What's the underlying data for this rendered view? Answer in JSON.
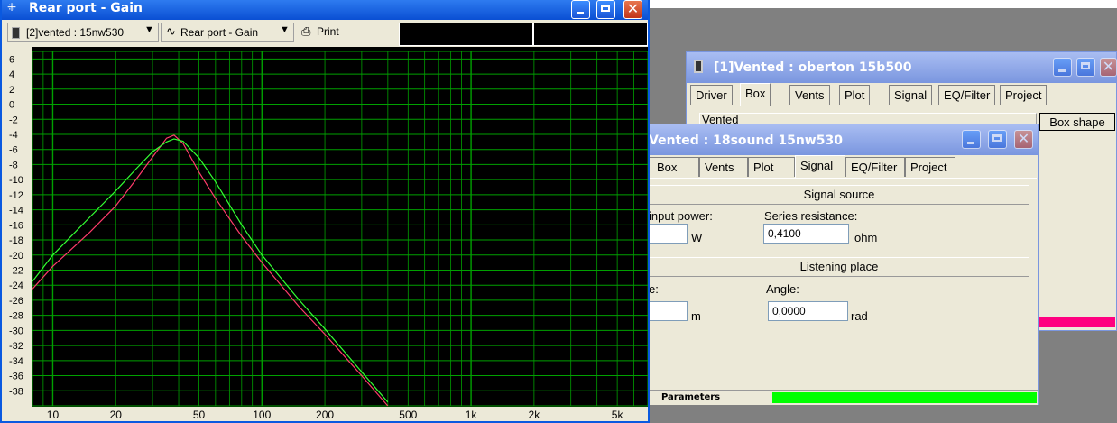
{
  "graph_window": {
    "title": "Rear port - Gain",
    "project_select": "[2]vented : 15nw530",
    "plot_select": "Rear port - Gain",
    "print_label": "Print"
  },
  "win_oberton": {
    "title": "[1]Vented : oberton 15b500",
    "tabs": [
      "Driver",
      "Box",
      "Vents",
      "Plot",
      "Signal",
      "EQ/Filter",
      "Project"
    ],
    "active_tab": "Box",
    "section_label": "Vented",
    "box_shape_button": "Box shape"
  },
  "win_18sound": {
    "title": "Vented : 18sound 15nw530",
    "tabs": [
      "Box",
      "Vents",
      "Plot",
      "Signal",
      "EQ/Filter",
      "Project"
    ],
    "active_tab": "Signal",
    "signal_source_header": "Signal source",
    "input_power_label": "input power:",
    "input_power_unit": "W",
    "series_resistance_label": "Series resistance:",
    "series_resistance_value": "0,4100",
    "series_resistance_unit": "ohm",
    "listening_place_header": "Listening place",
    "distance_label": "e:",
    "distance_unit": "m",
    "angle_label": "Angle:",
    "angle_value": "0,0000",
    "angle_unit": "rad",
    "status_label": "Parameters",
    "status_color": "#00ff00"
  },
  "colors": {
    "plot_bg": "#000000",
    "grid": "#00a000",
    "series_red": "#ff3b6b",
    "series_green": "#33ff33",
    "xp_title": "#0a59e0",
    "inactive_title": "#7a96df",
    "accent_magenta": "#ff007f"
  },
  "chart_data": {
    "type": "line",
    "title": "Rear port - Gain",
    "x_scale": "log",
    "xlim": [
      8,
      7000
    ],
    "ylim": [
      -40,
      7
    ],
    "x_ticks": [
      "10",
      "20",
      "50",
      "100",
      "200",
      "500",
      "1k",
      "2k",
      "5k"
    ],
    "y_ticks": [
      "6",
      "4",
      "2",
      "0",
      "-2",
      "-4",
      "-6",
      "-8",
      "-10",
      "-12",
      "-14",
      "-16",
      "-18",
      "-20",
      "-22",
      "-24",
      "-26",
      "-28",
      "-30",
      "-32",
      "-34",
      "-36",
      "-38"
    ],
    "grid": true,
    "series": [
      {
        "color": "#ff3b6b",
        "x": [
          8,
          10,
          15,
          20,
          25,
          30,
          35,
          38,
          42,
          50,
          60,
          80,
          100,
          150,
          200,
          300,
          400
        ],
        "y": [
          -24.5,
          -21.5,
          -17,
          -13.5,
          -10,
          -7,
          -4.5,
          -4.1,
          -5.2,
          -9,
          -12.5,
          -17.5,
          -21,
          -26.8,
          -30.5,
          -36,
          -40
        ]
      },
      {
        "color": "#33ff33",
        "x": [
          8,
          10,
          15,
          20,
          25,
          30,
          35,
          38,
          42,
          50,
          60,
          80,
          100,
          150,
          200,
          300,
          400
        ],
        "y": [
          -23.5,
          -20,
          -15,
          -11.5,
          -8.6,
          -6.3,
          -5,
          -4.6,
          -4.9,
          -7.1,
          -10.3,
          -16,
          -20,
          -25.9,
          -29.8,
          -35.5,
          -39.5
        ]
      }
    ]
  }
}
